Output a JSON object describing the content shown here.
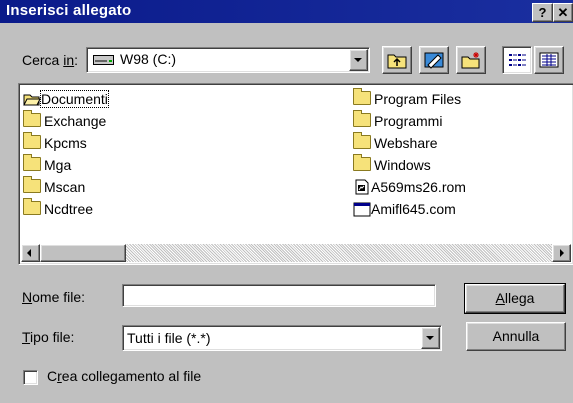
{
  "window": {
    "title": "Inserisci allegato",
    "help_label": "?",
    "close_label": "✕"
  },
  "lookin": {
    "label_pre": "Cerca ",
    "label_u": "in",
    "label_post": ":",
    "value": "W98 (C:)",
    "drive_icon": "drive-icon"
  },
  "toolbar": {
    "up": "up-folder-icon",
    "desktop": "desktop-icon",
    "newfolder": "new-folder-icon",
    "list": "list-view-icon",
    "details": "details-view-icon"
  },
  "files": {
    "col1": [
      "Documenti",
      "Exchange",
      "Kpcms",
      "Mga",
      "Mscan",
      "Ncdtree"
    ],
    "col2": [
      "Program Files",
      "Programmi",
      "Webshare",
      "Windows",
      "A569ms26.rom",
      "Amifl645.com"
    ]
  },
  "filename": {
    "label_u": "N",
    "label_rest": "ome file:",
    "value": ""
  },
  "filetype": {
    "label_u": "T",
    "label_rest": "ipo file:",
    "value": "Tutti i file (*.*)"
  },
  "buttons": {
    "attach_u": "A",
    "attach_rest": "llega",
    "cancel": "Annulla"
  },
  "checkbox": {
    "label_pre": "C",
    "label_u": "r",
    "label_post": "ea collegamento al file",
    "checked": false
  }
}
